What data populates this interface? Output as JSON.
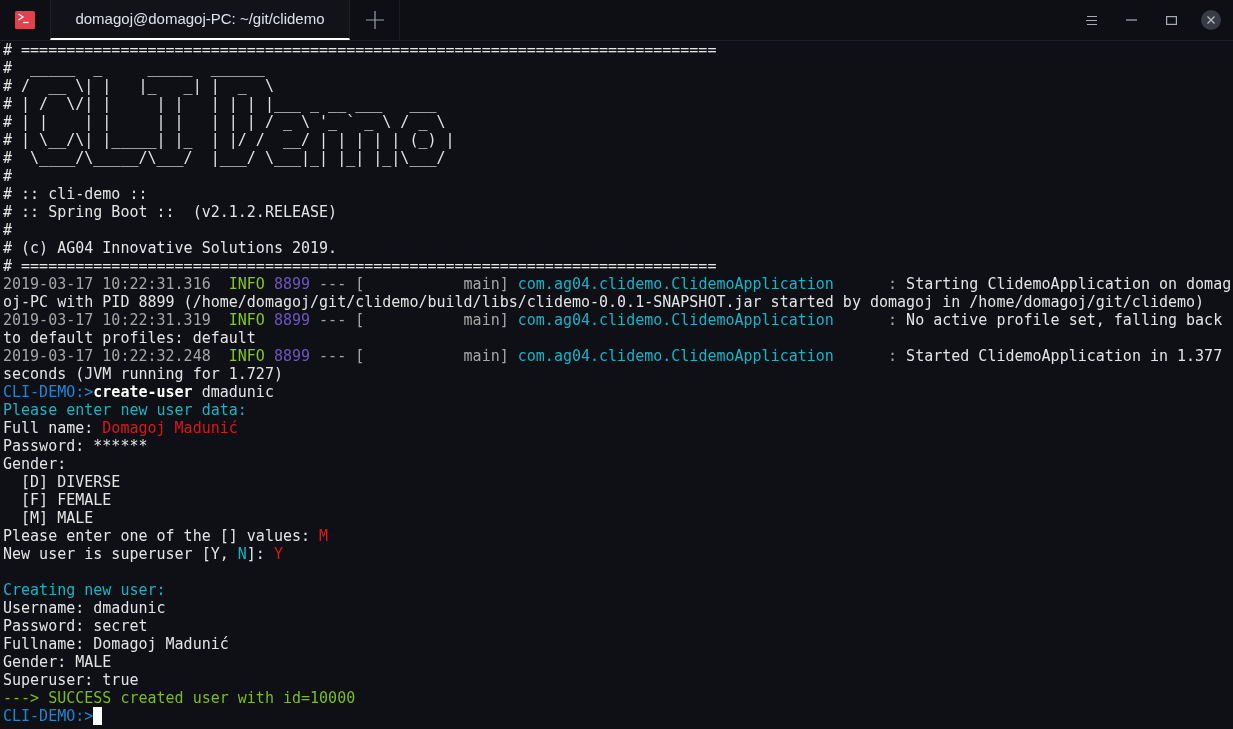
{
  "title_bar": {
    "tabs": [
      {
        "title": "domagoj@domagoj-PC: ~/git/clidemo",
        "selected": true
      }
    ]
  },
  "terminal": {
    "banner": [
      "# =============================================================================",
      "#  _____  _     _____  ______",
      "# /  __ \\| |   |_   _| |  _  \\",
      "# | /  \\/| |     | |   | | | |___ _ __ ___   ___",
      "# | |    | |     | |   | | | / _ \\ '_ ` _ \\ / _ \\",
      "# | \\__/\\| |_____| |_  | |/ /  __/ | | | | | (_) |",
      "#  \\____/\\_____/\\___/  |___/ \\___|_| |_| |_|\\___/",
      "#",
      "# :: cli-demo ::",
      "# :: Spring Boot ::  (v2.1.2.RELEASE)",
      "#",
      "# (c) AG04 Innovative Solutions 2019.",
      "# ============================================================================="
    ],
    "log": [
      [
        {
          "text": "2019-03-17 10:22:31.316",
          "kind": "faint"
        },
        {
          "text": "  INFO",
          "kind": "level"
        },
        {
          "text": " 8899",
          "kind": "pid"
        },
        {
          "text": " --- [           main] ",
          "kind": "faint"
        },
        {
          "text": "com.ag04.clidemo.ClidemoApplication",
          "kind": "logger"
        },
        {
          "text": "      : ",
          "kind": "faint"
        },
        {
          "text": "Starting ClidemoApplication on domag",
          "kind": "plain"
        }
      ],
      [
        {
          "text": "oj-PC with PID 8899 (/home/domagoj/git/clidemo/build/libs/clidemo-0.0.1-SNAPSHOT.jar started by domagoj in /home/domagoj/git/clidemo)",
          "kind": "plain"
        }
      ],
      [
        {
          "text": "2019-03-17 10:22:31.319",
          "kind": "faint"
        },
        {
          "text": "  INFO",
          "kind": "level"
        },
        {
          "text": " 8899",
          "kind": "pid"
        },
        {
          "text": " --- [           main] ",
          "kind": "faint"
        },
        {
          "text": "com.ag04.clidemo.ClidemoApplication",
          "kind": "logger"
        },
        {
          "text": "      : ",
          "kind": "faint"
        },
        {
          "text": "No active profile set, falling back",
          "kind": "plain"
        }
      ],
      [
        {
          "text": "to default profiles: default",
          "kind": "plain"
        }
      ],
      [
        {
          "text": "2019-03-17 10:22:32.248",
          "kind": "faint"
        },
        {
          "text": "  INFO",
          "kind": "level"
        },
        {
          "text": " 8899",
          "kind": "pid"
        },
        {
          "text": " --- [           main] ",
          "kind": "faint"
        },
        {
          "text": "com.ag04.clidemo.ClidemoApplication",
          "kind": "logger"
        },
        {
          "text": "      : ",
          "kind": "faint"
        },
        {
          "text": "Started ClidemoApplication in 1.377",
          "kind": "plain"
        }
      ],
      [
        {
          "text": "seconds (JVM running for 1.727)",
          "kind": "plain"
        }
      ]
    ],
    "session": [
      [
        {
          "text": "CLI-DEMO:>",
          "kind": "prompt"
        },
        {
          "text": "create-user",
          "kind": "command"
        },
        {
          "text": " dmadunic",
          "kind": "plain"
        }
      ],
      [
        {
          "text": "Please enter new user data:",
          "kind": "info"
        }
      ],
      [
        {
          "text": "Full name: ",
          "kind": "plain"
        },
        {
          "text": "Domagoj Madunić",
          "kind": "input"
        }
      ],
      [
        {
          "text": "Password: ******",
          "kind": "plain"
        }
      ],
      [
        {
          "text": "Gender:",
          "kind": "plain"
        }
      ],
      [
        {
          "text": "  [D] DIVERSE",
          "kind": "plain"
        }
      ],
      [
        {
          "text": "  [F] FEMALE",
          "kind": "plain"
        }
      ],
      [
        {
          "text": "  [M] MALE",
          "kind": "plain"
        }
      ],
      [
        {
          "text": "Please enter one of the [] values: ",
          "kind": "plain"
        },
        {
          "text": "M",
          "kind": "input"
        }
      ],
      [
        {
          "text": "New user is superuser [Y, ",
          "kind": "plain"
        },
        {
          "text": "N",
          "kind": "info"
        },
        {
          "text": "]: ",
          "kind": "plain"
        },
        {
          "text": "Y",
          "kind": "input"
        }
      ]
    ],
    "summary": [
      [
        {
          "text": "Creating new user:",
          "kind": "info"
        }
      ],
      [
        {
          "text": "Username: dmadunic",
          "kind": "plain"
        }
      ],
      [
        {
          "text": "Password: secret",
          "kind": "plain"
        }
      ],
      [
        {
          "text": "Fullname: Domagoj Madunić",
          "kind": "plain"
        }
      ],
      [
        {
          "text": "Gender: MALE",
          "kind": "plain"
        }
      ],
      [
        {
          "text": "Superuser: true",
          "kind": "plain"
        }
      ],
      [
        {
          "text": "---> SUCCESS created user with id=10000",
          "kind": "success"
        }
      ]
    ],
    "prompt": {
      "text": "CLI-DEMO:>",
      "cursor": true
    }
  }
}
